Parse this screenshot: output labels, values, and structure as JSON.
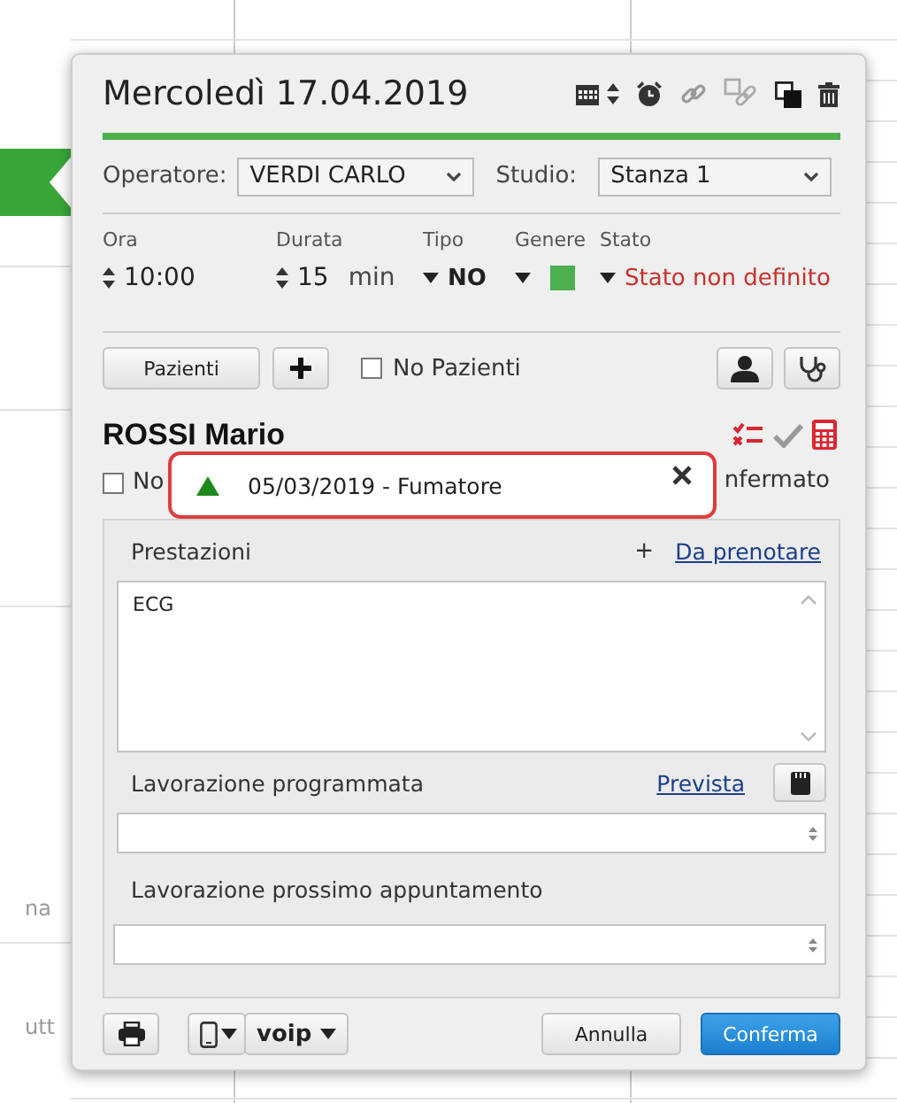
{
  "background": {
    "texts": [
      "na",
      "utt"
    ]
  },
  "title": "Mercoledì 17.04.2019",
  "operator": {
    "label": "Operatore:",
    "value": "VERDI CARLO"
  },
  "studio": {
    "label": "Studio:",
    "value": "Stanza 1"
  },
  "fields": [
    {
      "kind": "spinner",
      "label": "Ora",
      "value": "10:00"
    },
    {
      "kind": "spinner",
      "label": "Durata",
      "value": "15",
      "unit": "min"
    },
    {
      "kind": "dropdown",
      "label": "Tipo",
      "value": "NO"
    },
    {
      "kind": "color",
      "label": "Genere",
      "color": "#4caf50"
    },
    {
      "kind": "status",
      "label": "Stato",
      "value": "Stato non definito"
    }
  ],
  "patients_button": "Pazienti",
  "no_patients": {
    "label": "No Pazienti",
    "checked": false
  },
  "patient_name": "ROSSI Mario",
  "row_checkbox": {
    "label": "No",
    "checked": false
  },
  "row_text": "nfermato",
  "alert": {
    "text": "05/03/2019 - Fumatore"
  },
  "prestazioni": {
    "label": "Prestazioni",
    "add": "+",
    "link": "Da prenotare",
    "items": [
      "ECG"
    ]
  },
  "lavorazione_programmata": {
    "label": "Lavorazione programmata",
    "link": "Prevista"
  },
  "lavorazione_prossimo": {
    "label": "Lavorazione prossimo appuntamento"
  },
  "footer": {
    "voip": "voip",
    "cancel": "Annulla",
    "confirm": "Conferma"
  }
}
